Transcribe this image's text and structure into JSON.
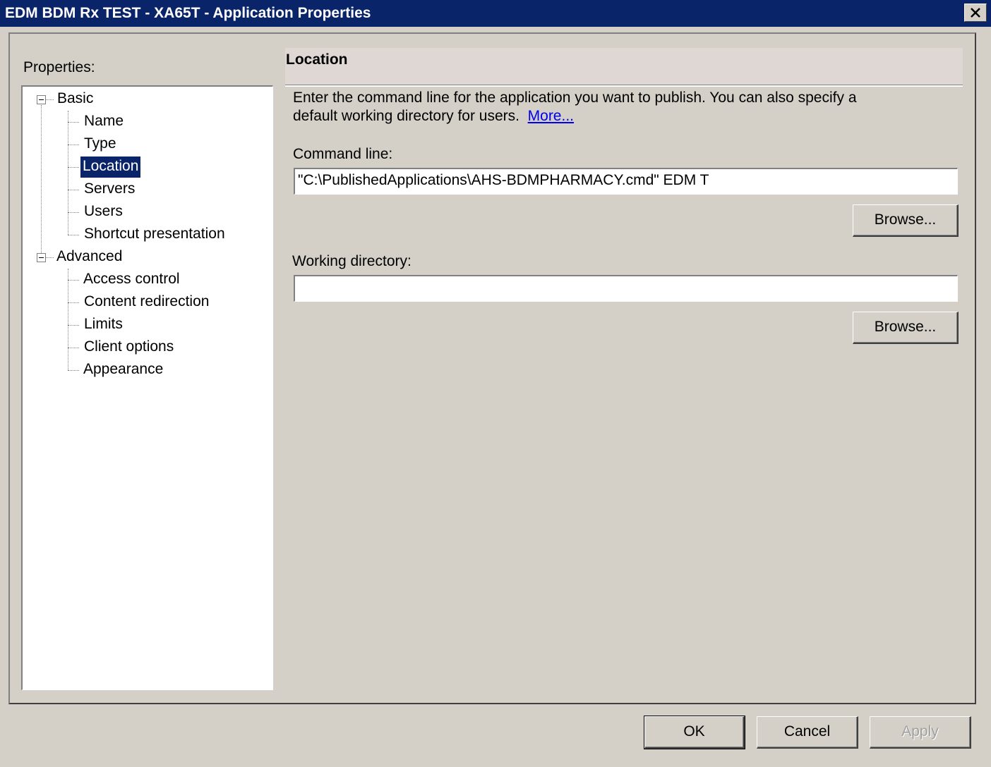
{
  "window": {
    "title": "EDM BDM Rx TEST - XA65T - Application Properties",
    "close_glyph": "✕"
  },
  "sidebar": {
    "label": "Properties:",
    "groups": [
      {
        "label": "Basic",
        "items": [
          "Name",
          "Type",
          "Location",
          "Servers",
          "Users",
          "Shortcut presentation"
        ]
      },
      {
        "label": "Advanced",
        "items": [
          "Access control",
          "Content redirection",
          "Limits",
          "Client options",
          "Appearance"
        ]
      }
    ],
    "selected": "Location"
  },
  "panel": {
    "title": "Location",
    "description_line1": "Enter the command line for the application you want to publish.  You can also specify a",
    "description_line2": "default working directory for users.",
    "more_link": "More...",
    "command_line_label": "Command line:",
    "command_line_value": "\"C:\\PublishedApplications\\AHS-BDMPHARMACY.cmd\" EDM T",
    "browse_label": "Browse...",
    "working_dir_label": "Working directory:",
    "working_dir_value": ""
  },
  "footer": {
    "ok_label": "OK",
    "cancel_label": "Cancel",
    "apply_label": "Apply"
  }
}
